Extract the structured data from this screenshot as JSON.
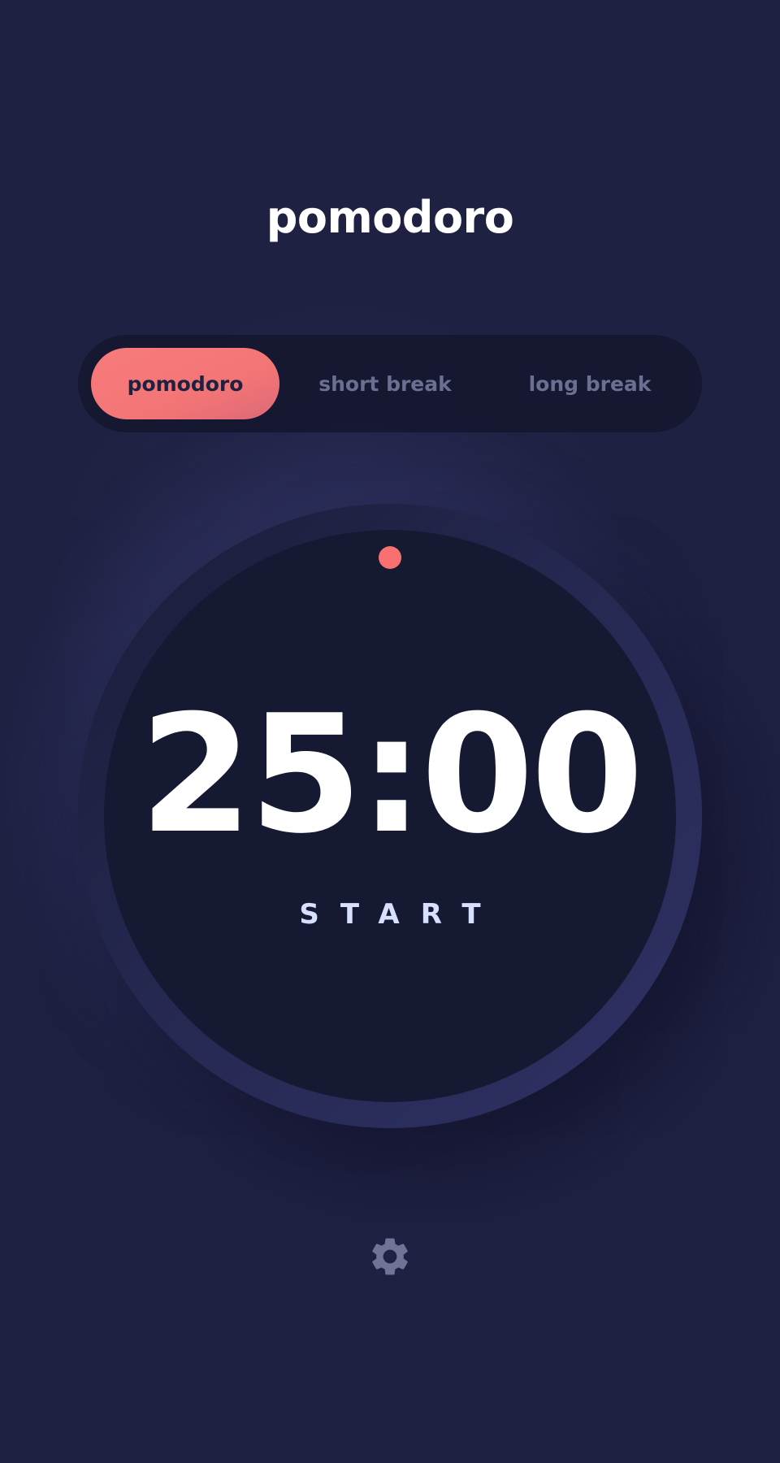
{
  "app": {
    "title": "pomodoro"
  },
  "modes": {
    "tabs": [
      {
        "label": "pomodoro",
        "active": true
      },
      {
        "label": "short break",
        "active": false
      },
      {
        "label": "long break",
        "active": false
      }
    ]
  },
  "timer": {
    "time": "25:00",
    "action_label": "START",
    "progress_fraction": 0.0
  },
  "settings": {
    "icon": "gear-icon"
  },
  "colors": {
    "background": "#1f2142",
    "accent": "#f87070",
    "switcher_bg": "#161832",
    "timer_face": "#161932",
    "inactive_text": "#6b6f91",
    "text": "#ffffff"
  }
}
